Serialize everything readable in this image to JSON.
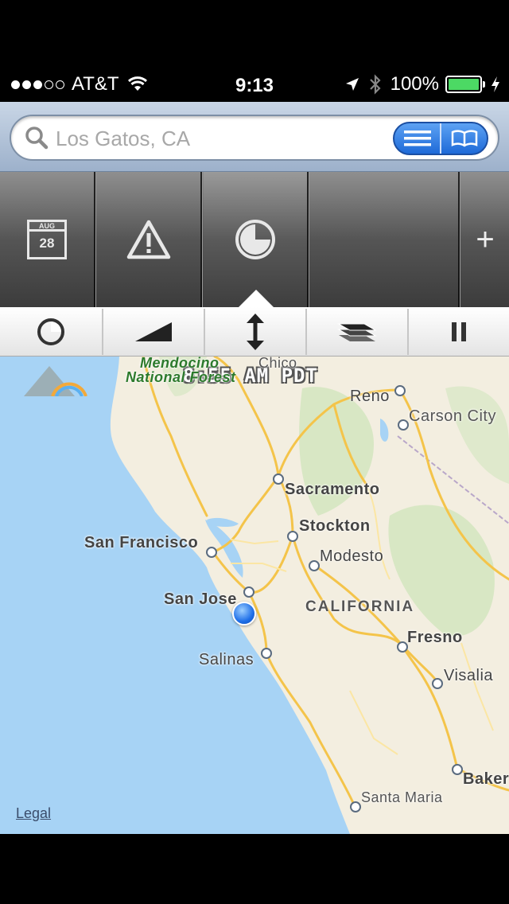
{
  "status_bar": {
    "carrier": "AT&T",
    "time": "9:13",
    "battery": "100%",
    "signal_bars_filled": 3,
    "signal_bars_total": 5
  },
  "search": {
    "placeholder": "Los Gatos, CA"
  },
  "toolbar": {
    "calendar_month": "AUG",
    "calendar_day": "28",
    "plus_label": "+"
  },
  "map": {
    "timestamp": "8:55 AM PDT",
    "legal": "Legal",
    "labels": {
      "mendocino": "Mendocino",
      "national_forest": "National Forest",
      "chico": "Chico",
      "reno": "Reno",
      "carson_city": "Carson City",
      "sacramento": "Sacramento",
      "stockton": "Stockton",
      "san_francisco": "San Francisco",
      "modesto": "Modesto",
      "san_jose": "San Jose",
      "california": "CALIFORNIA",
      "fresno": "Fresno",
      "salinas": "Salinas",
      "visalia": "Visalia",
      "bakersfield": "Baker",
      "santa_maria": "Santa Maria"
    }
  },
  "colors": {
    "ocean": "#a7d3f5",
    "land": "#f3eee0",
    "roads": "#f4c44a",
    "user_location": "#1f6fe8",
    "accent_blue": "#1e6ad8"
  }
}
